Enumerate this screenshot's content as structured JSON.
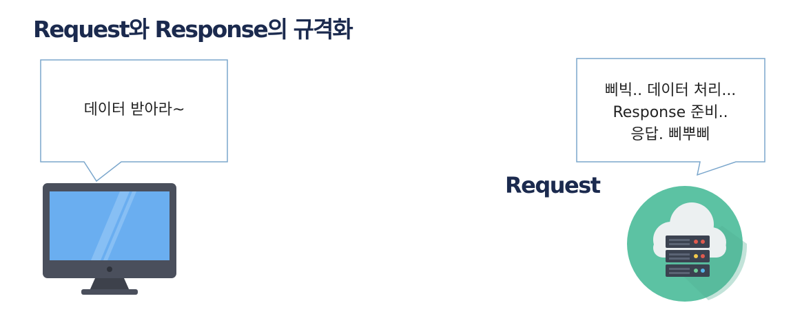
{
  "title": "Request와 Response의 규격화",
  "client_bubble": {
    "text": "데이터 받아라~"
  },
  "server_bubble": {
    "lines": [
      "삐빅.. 데이터 처리...",
      "Response 준비..",
      "응답. 삐뿌삐"
    ]
  },
  "request_label": "Request",
  "icons": {
    "client": "desktop-monitor-icon",
    "server": "cloud-server-icon"
  },
  "colors": {
    "title": "#1b2a4e",
    "bubble_border": "#7aa6cc",
    "monitor_body": "#4a4f5c",
    "monitor_screen": "#6aaef0",
    "cloud_circle": "#5cc2a3"
  }
}
